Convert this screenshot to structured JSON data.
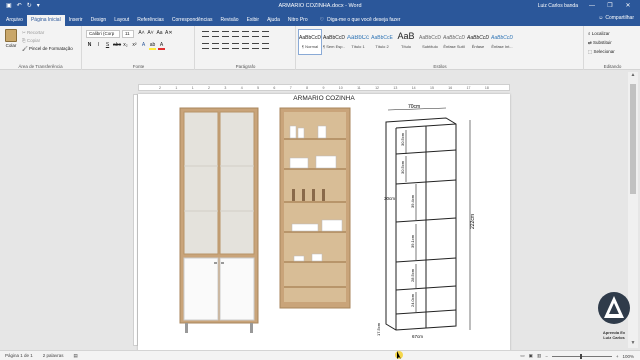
{
  "window": {
    "doc_title": "ARMARIO COZINHA.docx - Word",
    "user": "Luiz Carlos banda",
    "min_icon": "minimize-icon",
    "restore_icon": "restore-icon",
    "close_icon": "close-icon"
  },
  "tabs": [
    {
      "label": "Arquivo"
    },
    {
      "label": "Página Inicial"
    },
    {
      "label": "Inserir"
    },
    {
      "label": "Design"
    },
    {
      "label": "Layout"
    },
    {
      "label": "Referências"
    },
    {
      "label": "Correspondências"
    },
    {
      "label": "Revisão"
    },
    {
      "label": "Exibir"
    },
    {
      "label": "Ajuda"
    },
    {
      "label": "Nitro Pro"
    }
  ],
  "tell_me": "Diga-me o que você deseja fazer",
  "share": "Compartilhar",
  "ribbon": {
    "clipboard": {
      "paste": "Colar",
      "cut": "Recortar",
      "copy": "Copiar",
      "format_painter": "Pincel de Formatação",
      "label": "Área de Transferência"
    },
    "font": {
      "name": "Calibri (Corp",
      "size": "11",
      "label": "Fonte",
      "buttons": [
        "N",
        "I",
        "S",
        "abc",
        "x₂",
        "x²"
      ]
    },
    "paragraph": {
      "label": "Parágrafo"
    },
    "styles": {
      "label": "Estilos",
      "items": [
        {
          "sample": "AaBbCcDd",
          "name": "¶ Normal"
        },
        {
          "sample": "AaBbCcDd",
          "name": "¶ Sem Esp..."
        },
        {
          "sample": "AaBbCc",
          "name": "Título 1"
        },
        {
          "sample": "AaBbCcE",
          "name": "Título 2"
        },
        {
          "sample": "AaB",
          "name": "Título"
        },
        {
          "sample": "AaBbCcD",
          "name": "Subtítulo"
        },
        {
          "sample": "AaBbCcDd",
          "name": "Ênfase Sutil"
        },
        {
          "sample": "AaBbCcDd",
          "name": "Ênfase"
        },
        {
          "sample": "AaBbCcDd",
          "name": "Ênfase Int..."
        }
      ]
    },
    "editing": {
      "label": "Editando",
      "find": "Localizar",
      "replace": "Substituir",
      "select": "Selecionar"
    }
  },
  "ruler": {
    "numbers": [
      "2",
      "1",
      "1",
      "2",
      "3",
      "4",
      "5",
      "6",
      "7",
      "8",
      "9",
      "10",
      "11",
      "12",
      "13",
      "14",
      "15",
      "16",
      "17",
      "18"
    ]
  },
  "document": {
    "heading": "ARMARIO COZINHA",
    "dimensions": {
      "width": "70cm",
      "height": "222cm",
      "depth": "30cm",
      "shelf_a": "30.5cm",
      "shelf_b": "30.5cm",
      "shelf_c": "39.4cm",
      "shelf_d": "39.1cm",
      "shelf_e": "28.5cm",
      "shelf_f": "24.0cm",
      "base": "17.5cm",
      "inner_width": "67cm"
    }
  },
  "status": {
    "page": "Página 1 de 1",
    "words": "2 palavras",
    "zoom": "100%"
  },
  "watermark": {
    "line1": "Aprenda Ex",
    "line2": "Luiz Carlos"
  },
  "colors": {
    "word_blue": "#2b579a",
    "wood": "#c9a47a",
    "glass": "#e4e2dc"
  }
}
